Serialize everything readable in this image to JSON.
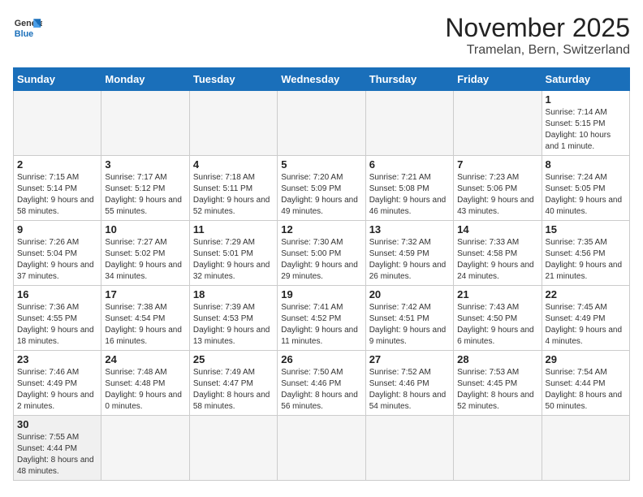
{
  "header": {
    "logo_general": "General",
    "logo_blue": "Blue",
    "month_title": "November 2025",
    "location": "Tramelan, Bern, Switzerland"
  },
  "days_of_week": [
    "Sunday",
    "Monday",
    "Tuesday",
    "Wednesday",
    "Thursday",
    "Friday",
    "Saturday"
  ],
  "weeks": [
    [
      {
        "day": "",
        "info": ""
      },
      {
        "day": "",
        "info": ""
      },
      {
        "day": "",
        "info": ""
      },
      {
        "day": "",
        "info": ""
      },
      {
        "day": "",
        "info": ""
      },
      {
        "day": "",
        "info": ""
      },
      {
        "day": "1",
        "info": "Sunrise: 7:14 AM\nSunset: 5:15 PM\nDaylight: 10 hours and 1 minute."
      }
    ],
    [
      {
        "day": "2",
        "info": "Sunrise: 7:15 AM\nSunset: 5:14 PM\nDaylight: 9 hours and 58 minutes."
      },
      {
        "day": "3",
        "info": "Sunrise: 7:17 AM\nSunset: 5:12 PM\nDaylight: 9 hours and 55 minutes."
      },
      {
        "day": "4",
        "info": "Sunrise: 7:18 AM\nSunset: 5:11 PM\nDaylight: 9 hours and 52 minutes."
      },
      {
        "day": "5",
        "info": "Sunrise: 7:20 AM\nSunset: 5:09 PM\nDaylight: 9 hours and 49 minutes."
      },
      {
        "day": "6",
        "info": "Sunrise: 7:21 AM\nSunset: 5:08 PM\nDaylight: 9 hours and 46 minutes."
      },
      {
        "day": "7",
        "info": "Sunrise: 7:23 AM\nSunset: 5:06 PM\nDaylight: 9 hours and 43 minutes."
      },
      {
        "day": "8",
        "info": "Sunrise: 7:24 AM\nSunset: 5:05 PM\nDaylight: 9 hours and 40 minutes."
      }
    ],
    [
      {
        "day": "9",
        "info": "Sunrise: 7:26 AM\nSunset: 5:04 PM\nDaylight: 9 hours and 37 minutes."
      },
      {
        "day": "10",
        "info": "Sunrise: 7:27 AM\nSunset: 5:02 PM\nDaylight: 9 hours and 34 minutes."
      },
      {
        "day": "11",
        "info": "Sunrise: 7:29 AM\nSunset: 5:01 PM\nDaylight: 9 hours and 32 minutes."
      },
      {
        "day": "12",
        "info": "Sunrise: 7:30 AM\nSunset: 5:00 PM\nDaylight: 9 hours and 29 minutes."
      },
      {
        "day": "13",
        "info": "Sunrise: 7:32 AM\nSunset: 4:59 PM\nDaylight: 9 hours and 26 minutes."
      },
      {
        "day": "14",
        "info": "Sunrise: 7:33 AM\nSunset: 4:58 PM\nDaylight: 9 hours and 24 minutes."
      },
      {
        "day": "15",
        "info": "Sunrise: 7:35 AM\nSunset: 4:56 PM\nDaylight: 9 hours and 21 minutes."
      }
    ],
    [
      {
        "day": "16",
        "info": "Sunrise: 7:36 AM\nSunset: 4:55 PM\nDaylight: 9 hours and 18 minutes."
      },
      {
        "day": "17",
        "info": "Sunrise: 7:38 AM\nSunset: 4:54 PM\nDaylight: 9 hours and 16 minutes."
      },
      {
        "day": "18",
        "info": "Sunrise: 7:39 AM\nSunset: 4:53 PM\nDaylight: 9 hours and 13 minutes."
      },
      {
        "day": "19",
        "info": "Sunrise: 7:41 AM\nSunset: 4:52 PM\nDaylight: 9 hours and 11 minutes."
      },
      {
        "day": "20",
        "info": "Sunrise: 7:42 AM\nSunset: 4:51 PM\nDaylight: 9 hours and 9 minutes."
      },
      {
        "day": "21",
        "info": "Sunrise: 7:43 AM\nSunset: 4:50 PM\nDaylight: 9 hours and 6 minutes."
      },
      {
        "day": "22",
        "info": "Sunrise: 7:45 AM\nSunset: 4:49 PM\nDaylight: 9 hours and 4 minutes."
      }
    ],
    [
      {
        "day": "23",
        "info": "Sunrise: 7:46 AM\nSunset: 4:49 PM\nDaylight: 9 hours and 2 minutes."
      },
      {
        "day": "24",
        "info": "Sunrise: 7:48 AM\nSunset: 4:48 PM\nDaylight: 9 hours and 0 minutes."
      },
      {
        "day": "25",
        "info": "Sunrise: 7:49 AM\nSunset: 4:47 PM\nDaylight: 8 hours and 58 minutes."
      },
      {
        "day": "26",
        "info": "Sunrise: 7:50 AM\nSunset: 4:46 PM\nDaylight: 8 hours and 56 minutes."
      },
      {
        "day": "27",
        "info": "Sunrise: 7:52 AM\nSunset: 4:46 PM\nDaylight: 8 hours and 54 minutes."
      },
      {
        "day": "28",
        "info": "Sunrise: 7:53 AM\nSunset: 4:45 PM\nDaylight: 8 hours and 52 minutes."
      },
      {
        "day": "29",
        "info": "Sunrise: 7:54 AM\nSunset: 4:44 PM\nDaylight: 8 hours and 50 minutes."
      }
    ],
    [
      {
        "day": "30",
        "info": "Sunrise: 7:55 AM\nSunset: 4:44 PM\nDaylight: 8 hours and 48 minutes."
      },
      {
        "day": "",
        "info": ""
      },
      {
        "day": "",
        "info": ""
      },
      {
        "day": "",
        "info": ""
      },
      {
        "day": "",
        "info": ""
      },
      {
        "day": "",
        "info": ""
      },
      {
        "day": "",
        "info": ""
      }
    ]
  ]
}
